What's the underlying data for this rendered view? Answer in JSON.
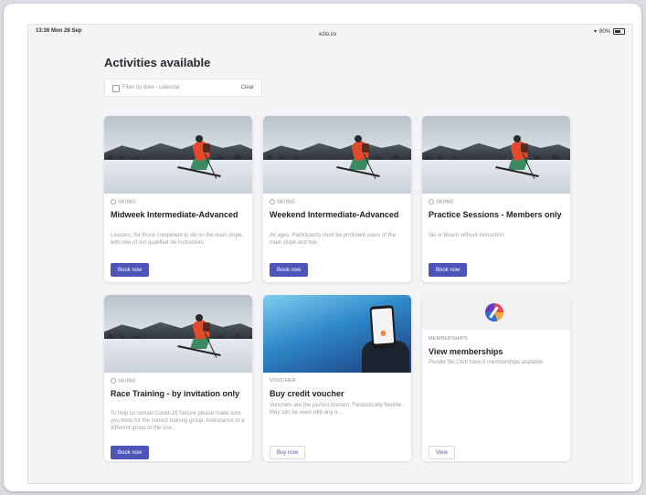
{
  "status": {
    "time": "13:36 Mon 28 Sep",
    "url": "ezlo.co",
    "battery": "80%"
  },
  "page": {
    "title": "Activities available"
  },
  "filter": {
    "placeholder": "Filter by date - calendar",
    "clear_label": "Clear"
  },
  "cards": [
    {
      "tag": "SKIING",
      "title": "Midweek Intermediate-Advanced",
      "desc": "Lessons, for those competent to ski on the main slope, with one of our qualified ski instructors",
      "button": "Book now",
      "image": "skier-photo"
    },
    {
      "tag": "SKIING",
      "title": "Weekend Intermediate-Advanced",
      "desc": "All ages. Participants must be proficient users of the main slope and tow.",
      "button": "Book now",
      "image": "skier-photo"
    },
    {
      "tag": "SKIING",
      "title": "Practice Sessions - Members only",
      "desc": "Ski or Board without instruction",
      "button": "Book now",
      "image": "skier-photo"
    },
    {
      "tag": "SKIING",
      "title": "Race Training - by invitation only",
      "desc": "To help us remain Covid-19 Secure please make sure you book for the correct training group. Attendance to a different group to the one...",
      "button": "Book now",
      "image": "skier-photo"
    },
    {
      "tag": "VOUCHER",
      "title": "Buy credit voucher",
      "desc": "Vouchers are the perfect present. Fantastically flexible - they can be used with any o...",
      "button": "Buy now",
      "image": "phone-photo"
    },
    {
      "tag": "MEMBERSHIPS",
      "title": "View memberships",
      "desc": "Pendle Ski Club have 8 memberships available",
      "button": "View",
      "image": "club-logo"
    }
  ],
  "colors": {
    "primary_button": "#4d56b8",
    "background": "#f4f4f6"
  }
}
